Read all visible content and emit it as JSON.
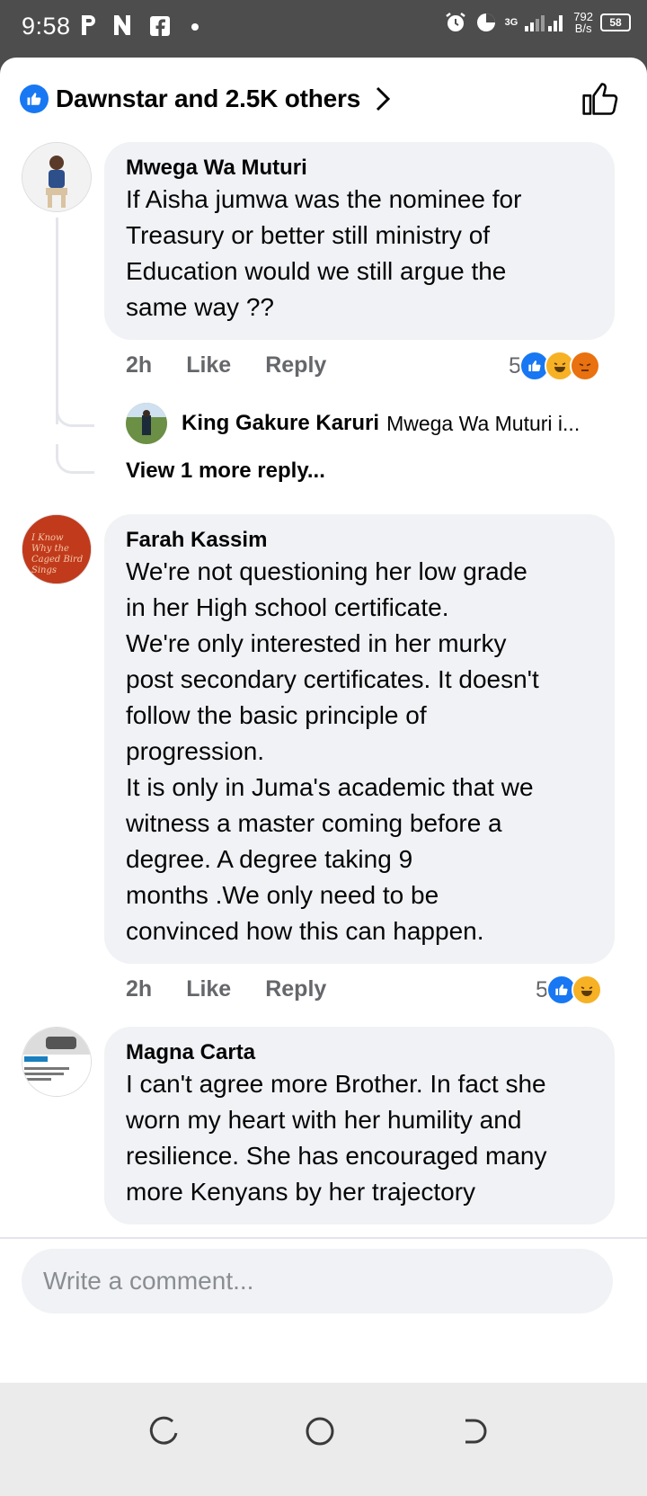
{
  "status_bar": {
    "time": "9:58",
    "net_gen": "3G",
    "speed_value": "792",
    "speed_unit": "B/s",
    "battery": "58"
  },
  "header": {
    "reactions_summary": "Dawnstar and 2.5K others"
  },
  "comments": [
    {
      "author": "Mwega Wa Muturi",
      "text": "If Aisha jumwa was the nominee for\nTreasury or better still ministry of\nEducation would we still argue the\nsame way ??",
      "time": "2h",
      "like_label": "Like",
      "reply_label": "Reply",
      "reaction_count": "5",
      "reply_preview": {
        "author": "King Gakure Karuri",
        "snippet": "Mwega Wa Muturi i..."
      },
      "view_more": "View 1 more reply..."
    },
    {
      "author": "Farah Kassim",
      "avatar_text": "I Know Why the Caged Bird Sings",
      "text": "We're not questioning her low grade\nin her High school certificate.\nWe're only interested in her murky\npost secondary certificates. It doesn't\nfollow the basic principle of\nprogression.\nIt is only in Juma's  academic that we\nwitness a master coming before a\ndegree. A degree taking 9\nmonths .We only need to be\nconvinced how this can happen.",
      "time": "2h",
      "like_label": "Like",
      "reply_label": "Reply",
      "reaction_count": "5"
    },
    {
      "author": "Magna Carta",
      "text": "I can't agree more Brother. In fact she\nworn my heart with her humility and\nresilience. She has encouraged many\nmore Kenyans by her trajectory"
    }
  ],
  "composer": {
    "placeholder": "Write a comment..."
  },
  "colors": {
    "facebook_blue": "#1877f2",
    "bubble_bg": "#f0f2f5",
    "meta_gray": "#65676b"
  }
}
